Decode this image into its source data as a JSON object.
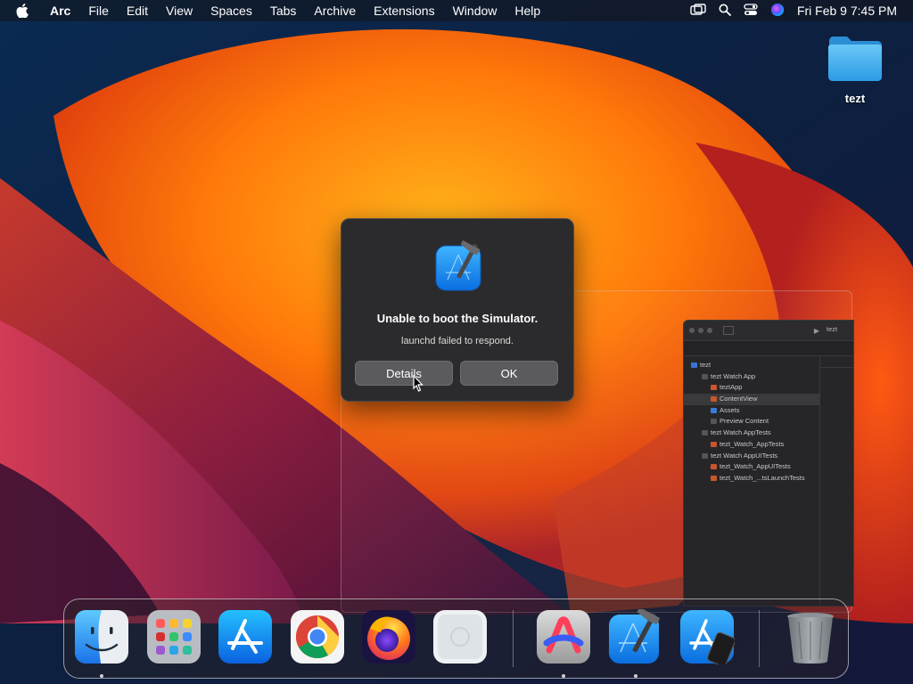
{
  "menubar": {
    "app_name": "Arc",
    "menus": [
      "File",
      "Edit",
      "View",
      "Spaces",
      "Tabs",
      "Archive",
      "Extensions",
      "Window",
      "Help"
    ],
    "clock": "Fri Feb 9  7:45 PM"
  },
  "desktop": {
    "folder_label": "tezt"
  },
  "dialog": {
    "title": "Unable to boot the Simulator.",
    "message": "launchd failed to respond.",
    "details_label": "Details",
    "ok_label": "OK"
  },
  "xcode_window": {
    "tab_title": "tezt",
    "navigator": [
      "tezt",
      "tezt Watch App",
      "teztApp",
      "ContentView",
      "Assets",
      "Preview Content",
      "tezt Watch AppTests",
      "tezt_Watch_AppTests",
      "tezt Watch AppUITests",
      "tezt_Watch_AppUITests",
      "tezt_Watch_...tsLaunchTests"
    ]
  },
  "dock": {
    "apps": [
      "Finder",
      "Launchpad",
      "App Store",
      "Google Chrome",
      "Firefox",
      "Preview",
      "Arc",
      "Xcode",
      "Simulator",
      "Trash"
    ]
  },
  "colors": {
    "dialog_bg": "#2b2b2d",
    "button_bg": "#5b5b5f",
    "xcode_blue": "#1d8ef5"
  }
}
